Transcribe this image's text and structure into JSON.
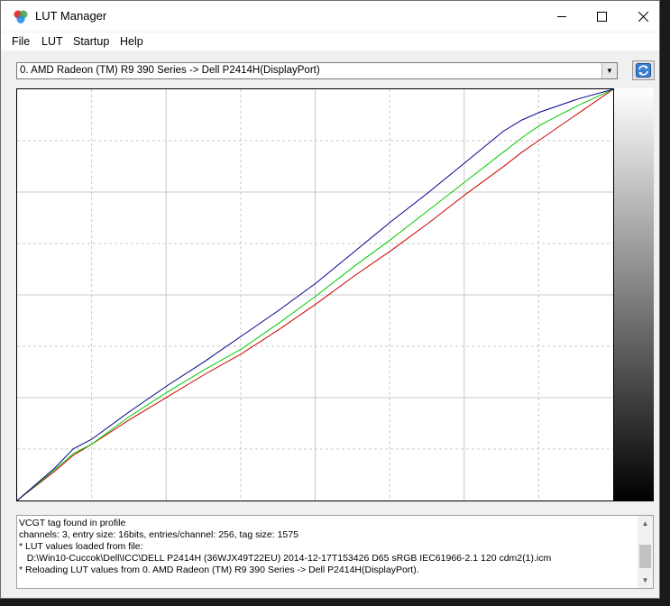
{
  "window": {
    "title": "LUT Manager"
  },
  "menu": [
    {
      "label": "File"
    },
    {
      "label": "LUT"
    },
    {
      "label": "Startup"
    },
    {
      "label": "Help"
    }
  ],
  "device_select": {
    "selected": "0. AMD Radeon (TM) R9 390 Series -> Dell P2414H(DisplayPort)"
  },
  "icons": {
    "app": "color-circles-icon",
    "refresh": "refresh-icon",
    "minimize": "minimize-icon",
    "maximize": "maximize-icon",
    "close": "close-icon"
  },
  "chart_data": {
    "type": "line",
    "xlim": [
      0,
      255
    ],
    "ylim": [
      0,
      255
    ],
    "grid": true,
    "series": [
      {
        "color": "#cc0000",
        "x": [
          0,
          16,
          24,
          32,
          48,
          64,
          80,
          96,
          112,
          128,
          144,
          160,
          176,
          192,
          208,
          216,
          224,
          240,
          255
        ],
        "y": [
          0,
          18,
          28,
          35,
          50,
          64,
          78,
          91,
          106,
          122,
          139,
          155,
          172,
          190,
          207,
          216,
          224,
          240,
          255
        ]
      },
      {
        "color": "#00cc00",
        "x": [
          0,
          16,
          24,
          32,
          48,
          64,
          80,
          96,
          112,
          128,
          144,
          160,
          176,
          192,
          208,
          216,
          224,
          240,
          255
        ],
        "y": [
          0,
          19,
          29,
          35,
          52,
          67,
          81,
          94,
          110,
          127,
          145,
          162,
          180,
          198,
          216,
          225,
          233,
          245,
          255
        ]
      },
      {
        "color": "#00008b",
        "x": [
          0,
          16,
          24,
          32,
          48,
          64,
          80,
          96,
          112,
          128,
          144,
          160,
          176,
          192,
          208,
          216,
          224,
          240,
          255
        ],
        "y": [
          0,
          20,
          32,
          38,
          55,
          71,
          86,
          102,
          118,
          135,
          154,
          173,
          191,
          210,
          229,
          236,
          241,
          249,
          255
        ]
      }
    ]
  },
  "log": {
    "lines": [
      "VCGT tag found in profile",
      "channels: 3, entry size: 16bits, entries/channel: 256, tag size: 1575",
      "* LUT values loaded from file:",
      "   D:\\Win10-Cuccok\\Dell\\ICC\\DELL P2414H (36WJX49T22EU) 2014-12-17T153426 D65 sRGB IEC61966-2.1 120 cdm2(1).icm",
      "* Reloading LUT values from 0. AMD Radeon (TM) R9 390 Series -> Dell P2414H(DisplayPort)."
    ]
  }
}
